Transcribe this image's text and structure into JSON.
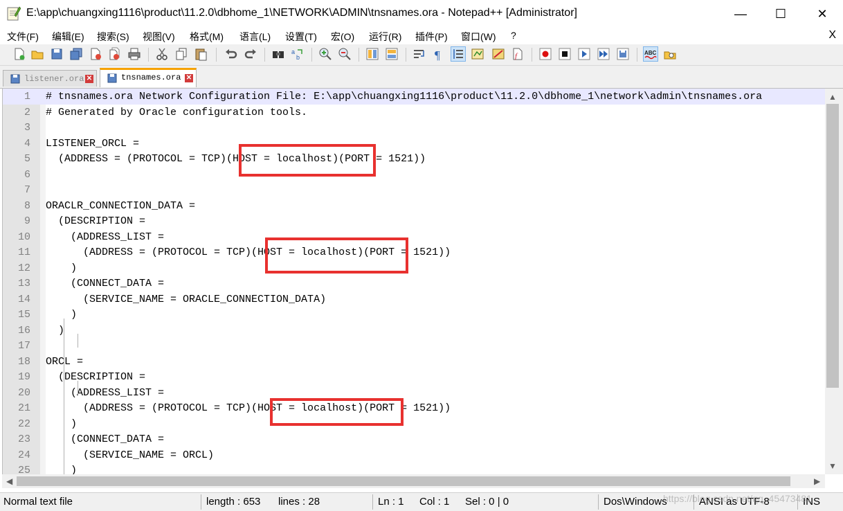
{
  "window": {
    "title": "E:\\app\\chuangxing1116\\product\\11.2.0\\dbhome_1\\NETWORK\\ADMIN\\tnsnames.ora - Notepad++ [Administrator]",
    "minimize": "—",
    "maximize": "☐",
    "close": "✕"
  },
  "menu": {
    "items": [
      "文件(F)",
      "编辑(E)",
      "搜索(S)",
      "视图(V)",
      "格式(M)",
      "语言(L)",
      "设置(T)",
      "宏(O)",
      "运行(R)",
      "插件(P)",
      "窗口(W)",
      "?"
    ],
    "close_doc": "X"
  },
  "tabs": [
    {
      "label": "listener.ora",
      "active": false
    },
    {
      "label": "tnsnames.ora",
      "active": true
    }
  ],
  "editor": {
    "lines": [
      {
        "n": "1",
        "text": "# tnsnames.ora Network Configuration File: E:\\app\\chuangxing1116\\product\\11.2.0\\dbhome_1\\network\\admin\\tnsnames.ora"
      },
      {
        "n": "2",
        "text": "# Generated by Oracle configuration tools."
      },
      {
        "n": "3",
        "text": ""
      },
      {
        "n": "4",
        "text": "LISTENER_ORCL ="
      },
      {
        "n": "5",
        "text": "  (ADDRESS = (PROTOCOL = TCP)(HOST = localhost)(PORT = 1521))"
      },
      {
        "n": "6",
        "text": ""
      },
      {
        "n": "7",
        "text": ""
      },
      {
        "n": "8",
        "text": "ORACLR_CONNECTION_DATA ="
      },
      {
        "n": "9",
        "text": "  (DESCRIPTION ="
      },
      {
        "n": "10",
        "text": "    (ADDRESS_LIST ="
      },
      {
        "n": "11",
        "text": "      (ADDRESS = (PROTOCOL = TCP)(HOST = localhost)(PORT = 1521))"
      },
      {
        "n": "12",
        "text": "    )"
      },
      {
        "n": "13",
        "text": "    (CONNECT_DATA ="
      },
      {
        "n": "14",
        "text": "      (SERVICE_NAME = ORACLE_CONNECTION_DATA)"
      },
      {
        "n": "15",
        "text": "    )"
      },
      {
        "n": "16",
        "text": "  )"
      },
      {
        "n": "17",
        "text": ""
      },
      {
        "n": "18",
        "text": "ORCL ="
      },
      {
        "n": "19",
        "text": "  (DESCRIPTION ="
      },
      {
        "n": "20",
        "text": "    (ADDRESS_LIST ="
      },
      {
        "n": "21",
        "text": "      (ADDRESS = (PROTOCOL = TCP)(HOST = localhost)(PORT = 1521))"
      },
      {
        "n": "22",
        "text": "    )"
      },
      {
        "n": "23",
        "text": "    (CONNECT_DATA ="
      },
      {
        "n": "24",
        "text": "      (SERVICE_NAME = ORCL)"
      },
      {
        "n": "25",
        "text": "    )"
      }
    ]
  },
  "status": {
    "file_type": "Normal text file",
    "length": "length : 653",
    "lines": "lines : 28",
    "ln": "Ln : 1",
    "col": "Col : 1",
    "sel": "Sel : 0 | 0",
    "eol": "Dos\\Windows",
    "encoding": "ANSI as UTF-8",
    "mode": "INS",
    "watermark": "https://blog.csdn.net/qq_45473481"
  },
  "colors": {
    "highlight_box": "#e8312f",
    "active_tab_accent": "#f6a200",
    "current_line": "#e8e8ff"
  }
}
